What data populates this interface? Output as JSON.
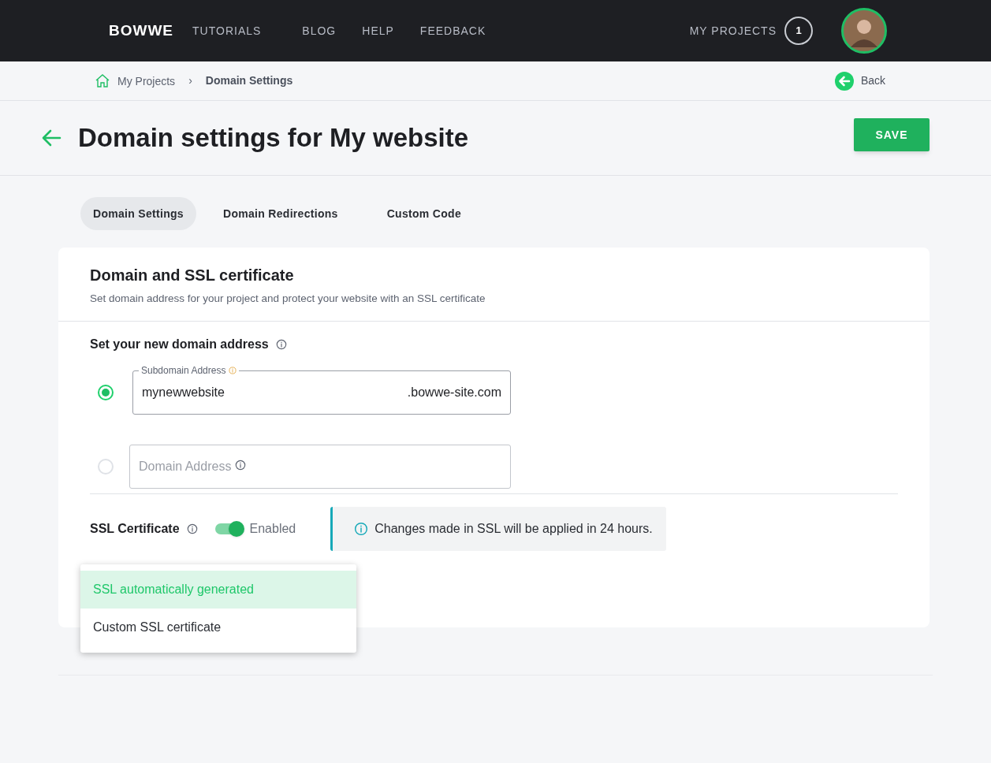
{
  "header": {
    "logo": "BOWWE",
    "nav": [
      {
        "label": "TUTORIALS"
      },
      {
        "label": "BLOG"
      },
      {
        "label": "HELP"
      },
      {
        "label": "FEEDBACK"
      }
    ],
    "projects": {
      "label": "MY PROJECTS",
      "count": "1"
    }
  },
  "breadcrumb": {
    "items": [
      "My Projects",
      "Domain Settings"
    ],
    "separator": "›",
    "back": "Back"
  },
  "page": {
    "title": "Domain settings for My website",
    "save": "SAVE"
  },
  "tabs": [
    {
      "label": "Domain Settings",
      "selected": true
    },
    {
      "label": "Domain Redirections",
      "selected": false
    },
    {
      "label": "Custom Code",
      "selected": false
    }
  ],
  "card": {
    "title": "Domain and SSL certificate",
    "subtitle": "Set domain address for your project and protect your website with an SSL certificate",
    "domain_section": {
      "label": "Set your new domain address",
      "options": [
        {
          "kind": "subdomain",
          "selected": true,
          "label": "Subdomain Address",
          "value": "mynewwebsite",
          "suffix": ".bowwe-site.com"
        },
        {
          "kind": "domain",
          "selected": false,
          "placeholder": "Domain Address"
        }
      ]
    },
    "ssl": {
      "label": "SSL Certificate",
      "on": true,
      "state_label": "Enabled",
      "notice": "Changes made in SSL will be applied in 24 hours."
    },
    "ssl_type_menu": [
      {
        "label": "SSL automatically generated",
        "selected": true
      },
      {
        "label": "Custom SSL certificate",
        "selected": false
      }
    ]
  }
}
